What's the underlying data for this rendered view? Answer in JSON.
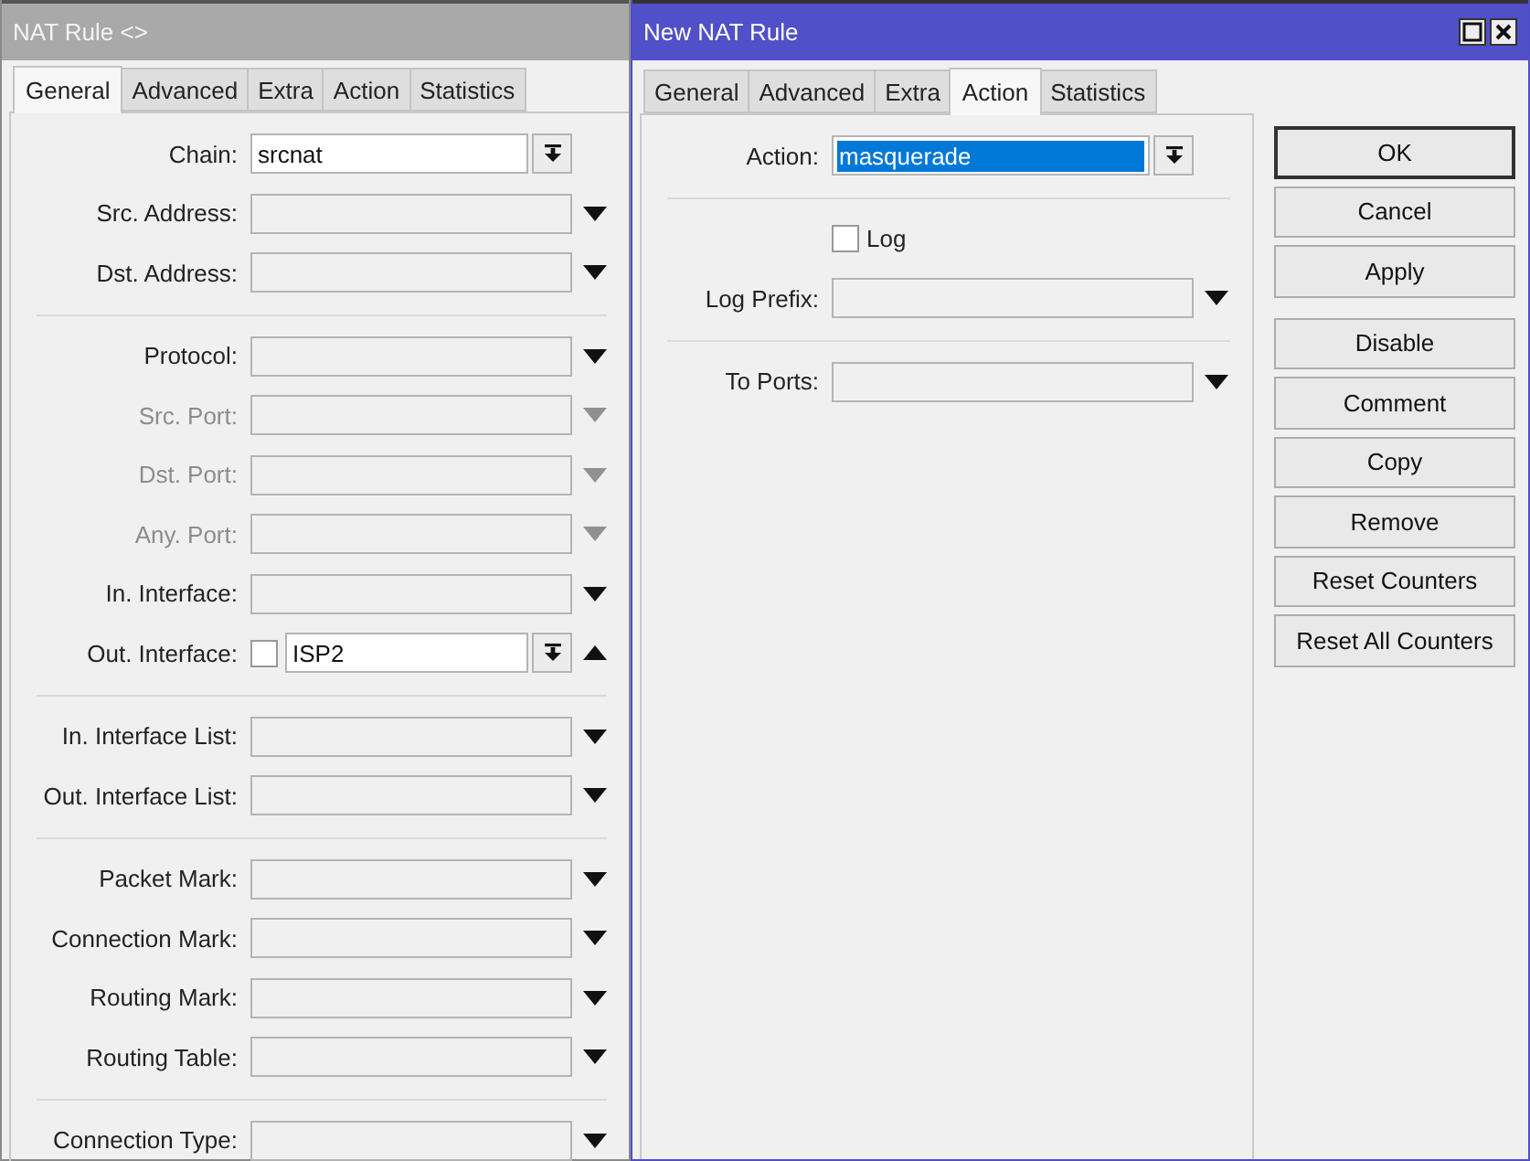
{
  "windows": [
    {
      "title": "NAT Rule <>",
      "active": false,
      "tabs": [
        {
          "label": "General",
          "selected": true
        },
        {
          "label": "Advanced",
          "selected": false
        },
        {
          "label": "Extra",
          "selected": false
        },
        {
          "label": "Action",
          "selected": false
        },
        {
          "label": "Statistics",
          "selected": false
        }
      ],
      "sections": [
        [
          {
            "label": "Chain:",
            "kind": "select",
            "value": "srcnat",
            "disabled": false
          },
          {
            "label": "Src. Address:",
            "kind": "list",
            "disabled": false,
            "expanded": false
          },
          {
            "label": "Dst. Address:",
            "kind": "list",
            "disabled": false,
            "expanded": false
          }
        ],
        [
          {
            "label": "Protocol:",
            "kind": "list",
            "disabled": false,
            "expanded": false
          },
          {
            "label": "Src. Port:",
            "kind": "list",
            "disabled": true,
            "expanded": false
          },
          {
            "label": "Dst. Port:",
            "kind": "list",
            "disabled": true,
            "expanded": false
          },
          {
            "label": "Any. Port:",
            "kind": "list",
            "disabled": true,
            "expanded": false
          },
          {
            "label": "In. Interface:",
            "kind": "list",
            "disabled": false,
            "expanded": false
          },
          {
            "label": "Out. Interface:",
            "kind": "negatable-select",
            "value": "ISP2",
            "negated": false,
            "disabled": false,
            "expanded": true
          }
        ],
        [
          {
            "label": "In. Interface List:",
            "kind": "list",
            "disabled": false,
            "expanded": false
          },
          {
            "label": "Out. Interface List:",
            "kind": "list",
            "disabled": false,
            "expanded": false
          }
        ],
        [
          {
            "label": "Packet Mark:",
            "kind": "list",
            "disabled": false,
            "expanded": false
          },
          {
            "label": "Connection Mark:",
            "kind": "list",
            "disabled": false,
            "expanded": false
          },
          {
            "label": "Routing Mark:",
            "kind": "list",
            "disabled": false,
            "expanded": false
          },
          {
            "label": "Routing Table:",
            "kind": "list",
            "disabled": false,
            "expanded": false
          }
        ],
        [
          {
            "label": "Connection Type:",
            "kind": "list",
            "disabled": false,
            "expanded": false
          }
        ]
      ]
    },
    {
      "title": "New NAT Rule",
      "active": true,
      "tabs": [
        {
          "label": "General",
          "selected": false
        },
        {
          "label": "Advanced",
          "selected": false
        },
        {
          "label": "Extra",
          "selected": false
        },
        {
          "label": "Action",
          "selected": true
        },
        {
          "label": "Statistics",
          "selected": false
        }
      ],
      "sections": [
        [
          {
            "label": "Action:",
            "kind": "select",
            "value": "masquerade",
            "highlighted": true,
            "disabled": false
          }
        ],
        [
          {
            "kind": "checkbox",
            "label": "Log",
            "checked": false
          },
          {
            "label": "Log Prefix:",
            "kind": "list",
            "disabled": false,
            "expanded": false
          }
        ],
        [
          {
            "label": "To Ports:",
            "kind": "list",
            "disabled": false,
            "expanded": false
          }
        ]
      ],
      "button_groups": [
        [
          {
            "label": "OK",
            "default": true
          },
          {
            "label": "Cancel",
            "default": false
          },
          {
            "label": "Apply",
            "default": false
          }
        ],
        [
          {
            "label": "Disable",
            "default": false
          },
          {
            "label": "Comment",
            "default": false
          },
          {
            "label": "Copy",
            "default": false
          },
          {
            "label": "Remove",
            "default": false
          },
          {
            "label": "Reset Counters",
            "default": false
          },
          {
            "label": "Reset All Counters",
            "default": false
          }
        ]
      ]
    }
  ]
}
